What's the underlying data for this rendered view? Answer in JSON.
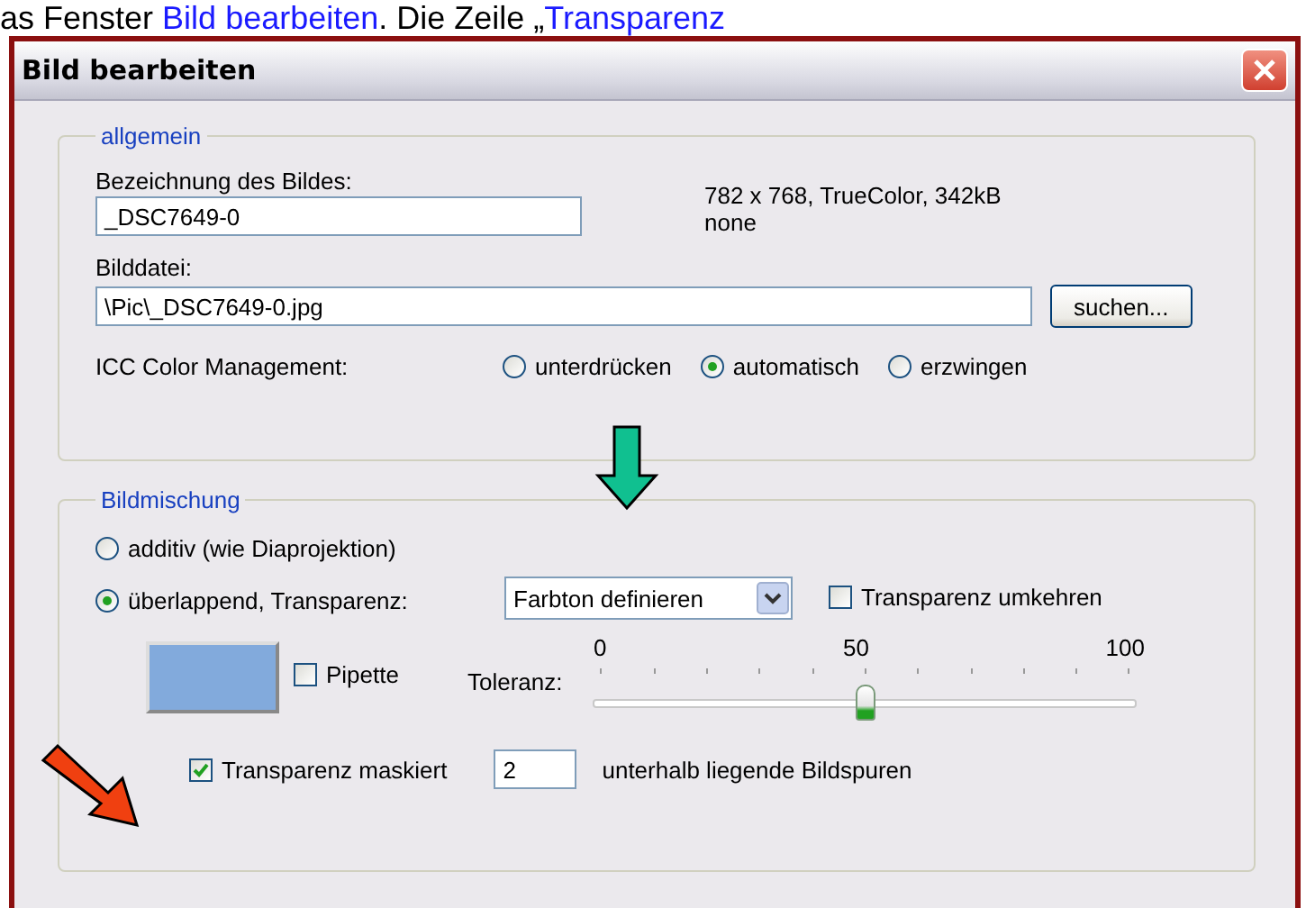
{
  "caption": {
    "parts": [
      {
        "kind": "text",
        "text": "as Fenster "
      },
      {
        "kind": "link",
        "text": "Bild bearbeiten"
      },
      {
        "kind": "text",
        "text": ". Die Zeile „"
      },
      {
        "kind": "link",
        "text": "Transparenz"
      }
    ]
  },
  "window": {
    "title": "Bild bearbeiten"
  },
  "general": {
    "legend": "allgemein",
    "name_label": "Bezeichnung des Bildes:",
    "name_value": "_DSC7649-0",
    "info": [
      "782 x 768, TrueColor, 342kB",
      "none"
    ],
    "file_label": "Bilddatei:",
    "file_value": "\\Pic\\_DSC7649-0.jpg",
    "browse_button": "suchen...",
    "icc_label": "ICC Color Management:",
    "icc_options": [
      {
        "label": "unterdrücken",
        "selected": false
      },
      {
        "label": "automatisch",
        "selected": true
      },
      {
        "label": "erzwingen",
        "selected": false
      }
    ]
  },
  "blend": {
    "legend": "Bildmischung",
    "modes": [
      {
        "label": "additiv (wie Diaprojektion)",
        "selected": false
      },
      {
        "label": "überlappend, Transparenz:",
        "selected": true
      }
    ],
    "transparency_select": "Farbton definieren",
    "invert": {
      "label": "Transparenz umkehren",
      "checked": false
    },
    "swatch": {
      "color": "#82aadc"
    },
    "pipette": {
      "label": "Pipette",
      "checked": false
    },
    "tolerance": {
      "label": "Toleranz:",
      "level": 0.5,
      "ticks": [
        "0",
        "50",
        "100"
      ]
    },
    "masked": {
      "label": "Transparenz maskiert",
      "checked": true
    },
    "layers_value": "2",
    "layers_label": "unterhalb liegende Bildspuren"
  }
}
